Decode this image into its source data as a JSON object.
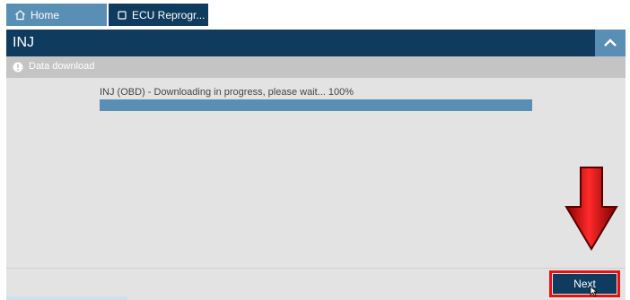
{
  "tabs": [
    {
      "label": "Home",
      "icon": "home-icon"
    },
    {
      "label": "ECU Reprogr...",
      "icon": "chip-icon"
    }
  ],
  "header": {
    "title": "INJ"
  },
  "section": {
    "label": "Data download",
    "icon": "info-icon"
  },
  "progress": {
    "text": "INJ (OBD) - Downloading in progress, please wait... 100%",
    "percent": 100
  },
  "footer": {
    "next_label": "Next"
  },
  "colors": {
    "navy": "#0f3c5e",
    "accent_blue": "#5a8fb5",
    "highlight_red": "#e81010"
  }
}
